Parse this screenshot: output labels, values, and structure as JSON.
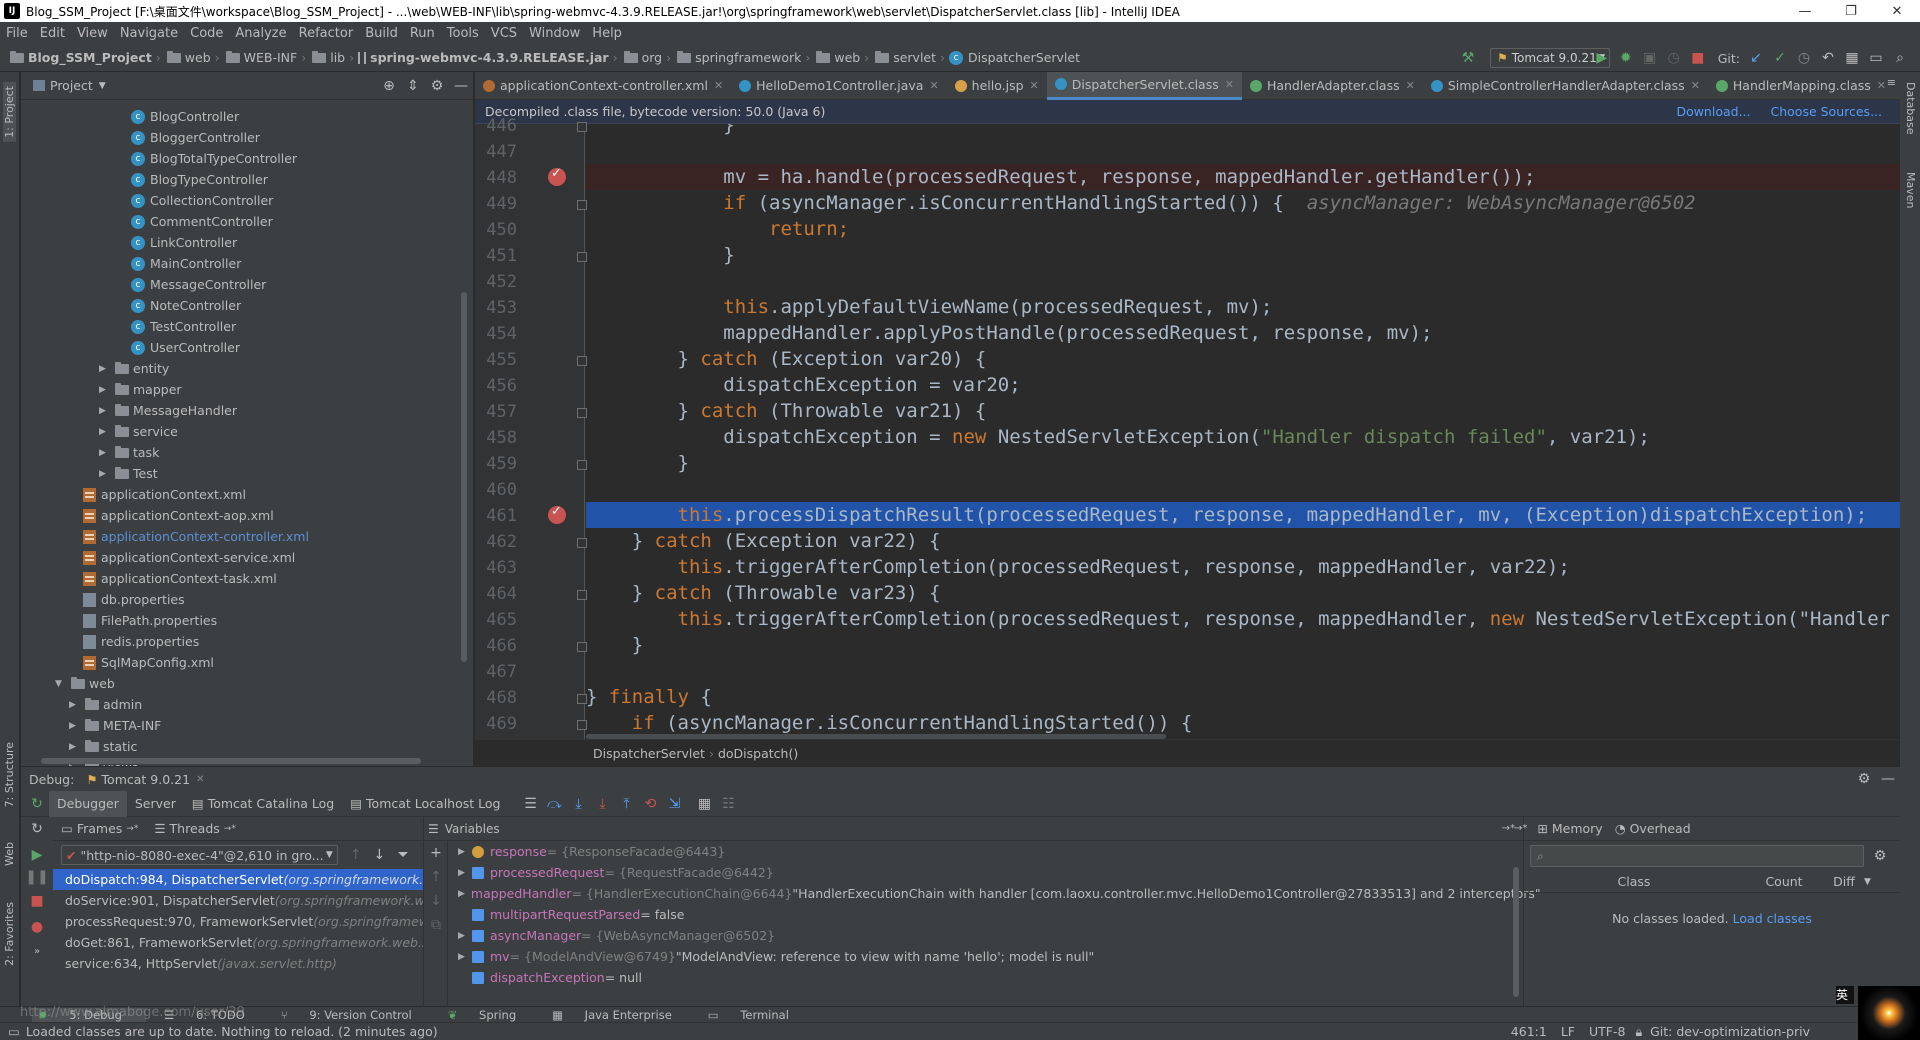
{
  "window": {
    "title": "Blog_SSM_Project [F:\\桌面文件\\workspace\\Blog_SSM_Project] - ...\\web\\WEB-INF\\lib\\spring-webmvc-4.3.9.RELEASE.jar!\\org\\springframework\\web\\servlet\\DispatcherServlet.class [lib] - IntelliJ IDEA"
  },
  "menu": [
    "File",
    "Edit",
    "View",
    "Navigate",
    "Code",
    "Analyze",
    "Refactor",
    "Build",
    "Run",
    "Tools",
    "VCS",
    "Window",
    "Help"
  ],
  "breadcrumb": [
    "Blog_SSM_Project",
    "web",
    "WEB-INF",
    "lib",
    "spring-webmvc-4.3.9.RELEASE.jar",
    "org",
    "springframework",
    "web",
    "servlet",
    "DispatcherServlet"
  ],
  "toolbar": {
    "run_config": "Tomcat 9.0.21",
    "git_label": "Git:"
  },
  "left_strip": [
    "1: Project",
    "7: Structure",
    "Web",
    "2: Favorites"
  ],
  "right_strip": [
    "Database",
    "Maven"
  ],
  "project": {
    "header": "Project",
    "items": [
      {
        "label": "BlogController",
        "type": "class"
      },
      {
        "label": "BloggerController",
        "type": "class"
      },
      {
        "label": "BlogTotalTypeController",
        "type": "class"
      },
      {
        "label": "BlogTypeController",
        "type": "class"
      },
      {
        "label": "CollectionController",
        "type": "class"
      },
      {
        "label": "CommentController",
        "type": "class"
      },
      {
        "label": "LinkController",
        "type": "class"
      },
      {
        "label": "MainController",
        "type": "class"
      },
      {
        "label": "MessageController",
        "type": "class"
      },
      {
        "label": "NoteController",
        "type": "class"
      },
      {
        "label": "TestController",
        "type": "class"
      },
      {
        "label": "UserController",
        "type": "class"
      },
      {
        "label": "entity",
        "type": "folder"
      },
      {
        "label": "mapper",
        "type": "folder"
      },
      {
        "label": "MessageHandler",
        "type": "folder"
      },
      {
        "label": "service",
        "type": "folder"
      },
      {
        "label": "task",
        "type": "folder"
      },
      {
        "label": "Test",
        "type": "folder"
      },
      {
        "label": "applicationContext.xml",
        "type": "xml"
      },
      {
        "label": "applicationContext-aop.xml",
        "type": "xml"
      },
      {
        "label": "applicationContext-controller.xml",
        "type": "xml",
        "highlight": true
      },
      {
        "label": "applicationContext-service.xml",
        "type": "xml"
      },
      {
        "label": "applicationContext-task.xml",
        "type": "xml"
      },
      {
        "label": "db.properties",
        "type": "props"
      },
      {
        "label": "FilePath.properties",
        "type": "props"
      },
      {
        "label": "redis.properties",
        "type": "props"
      },
      {
        "label": "SqlMapConfig.xml",
        "type": "xml"
      },
      {
        "label": "web",
        "type": "folder-open"
      },
      {
        "label": "admin",
        "type": "folder"
      },
      {
        "label": "META-INF",
        "type": "folder"
      },
      {
        "label": "static",
        "type": "folder"
      },
      {
        "label": "views",
        "type": "folder"
      }
    ]
  },
  "editor": {
    "tabs": [
      {
        "label": "applicationContext-controller.xml",
        "color": "#b06a33"
      },
      {
        "label": "HelloDemo1Controller.java",
        "color": "#3592c4"
      },
      {
        "label": "hello.jsp",
        "color": "#d6a04a"
      },
      {
        "label": "DispatcherServlet.class",
        "color": "#3592c4",
        "active": true
      },
      {
        "label": "HandlerAdapter.class",
        "color": "#59a869"
      },
      {
        "label": "SimpleControllerHandlerAdapter.class",
        "color": "#3592c4"
      },
      {
        "label": "HandlerMapping.class",
        "color": "#59a869"
      }
    ],
    "banner": "Decompiled .class file, bytecode version: 50.0 (Java 6)",
    "banner_download": "Download...",
    "banner_choose": "Choose Sources...",
    "line_numbers": [
      "446",
      "447",
      "448",
      "449",
      "450",
      "451",
      "452",
      "453",
      "454",
      "455",
      "456",
      "457",
      "458",
      "459",
      "460",
      "461",
      "462",
      "463",
      "464",
      "465",
      "466",
      "467",
      "468",
      "469"
    ],
    "bottom_crumb": [
      "DispatcherServlet",
      "doDispatch()"
    ]
  },
  "debug": {
    "label": "Debug:",
    "session": "Tomcat 9.0.21",
    "tabs": [
      "Debugger",
      "Server",
      "Tomcat Catalina Log",
      "Tomcat Localhost Log"
    ],
    "frames_tab": "Frames",
    "threads_tab": "Threads",
    "thread": "\"http-nio-8080-exec-4\"@2,610 in gro...",
    "frames": [
      {
        "method": "doDispatch:984, DispatcherServlet",
        "pkg": "(org.springframework.web"
      },
      {
        "method": "doService:901, DispatcherServlet",
        "pkg": "(org.springframework.web."
      },
      {
        "method": "processRequest:970, FrameworkServlet",
        "pkg": "(org.springframewor"
      },
      {
        "method": "doGet:861, FrameworkServlet",
        "pkg": "(org.springframework.web.ser"
      },
      {
        "method": "service:634, HttpServlet",
        "pkg": "(javax.servlet.http)"
      }
    ],
    "variables_title": "Variables",
    "variables": [
      {
        "name": "response",
        "type": "= {ResponseFacade@6443}",
        "value": ""
      },
      {
        "name": "processedRequest",
        "type": "= {RequestFacade@6442}",
        "value": ""
      },
      {
        "name": "mappedHandler",
        "type": "= {HandlerExecutionChain@6644}",
        "value": "\"HandlerExecutionChain with handler [com.laoxu.controller.mvc.HelloDemo1Controller@27833513] and 2 interceptors\""
      },
      {
        "name": "multipartRequestParsed",
        "type": "= false",
        "value": ""
      },
      {
        "name": "asyncManager",
        "type": "= {WebAsyncManager@6502}",
        "value": ""
      },
      {
        "name": "mv",
        "type": "= {ModelAndView@6749}",
        "value": "\"ModelAndView: reference to view with name 'hello'; model is null\""
      },
      {
        "name": "dispatchException",
        "type": "= null",
        "value": ""
      }
    ],
    "memory_tab": "Memory",
    "overhead_tab": "Overhead",
    "memory_cols": [
      "Class",
      "Count",
      "Diff"
    ],
    "memory_empty": "No classes loaded.",
    "memory_load": "Load classes"
  },
  "bottom_tabs": [
    "5: Debug",
    "6: TODO",
    "9: Version Control",
    "Spring",
    "Java Enterprise",
    "Terminal"
  ],
  "status": {
    "message": "Loaded classes are up to date. Nothing to reload. (2 minutes ago)",
    "watermark": "http://www.aimaboge.com/user/29",
    "position": "461:1",
    "line_sep": "LF",
    "encoding": "UTF-8",
    "branch": "Git: dev-optimization-priv",
    "ime": "英"
  }
}
